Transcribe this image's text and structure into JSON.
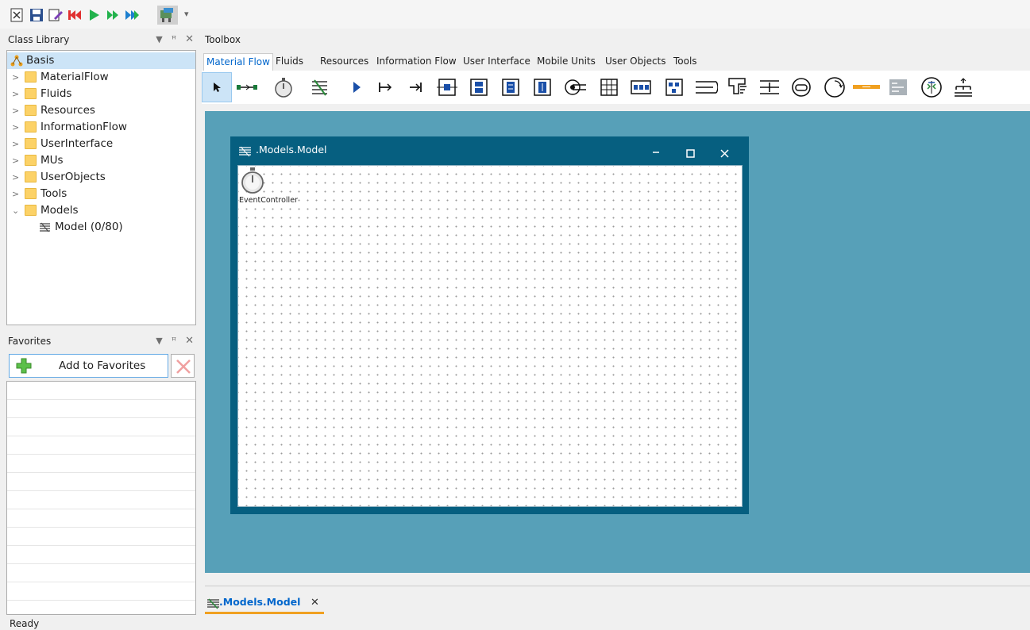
{
  "quick_access": {
    "buttons": [
      "new-icon",
      "save-icon",
      "open-icon",
      "reset-icon",
      "start-icon",
      "step-icon",
      "fast-forward-icon",
      "3d-view-icon"
    ],
    "overflow": "▾"
  },
  "class_library": {
    "title": "Class Library",
    "root": "Basis",
    "items": [
      {
        "label": "MaterialFlow",
        "expanded": false
      },
      {
        "label": "Fluids",
        "expanded": false
      },
      {
        "label": "Resources",
        "expanded": false
      },
      {
        "label": "InformationFlow",
        "expanded": false
      },
      {
        "label": "UserInterface",
        "expanded": false
      },
      {
        "label": "MUs",
        "expanded": false
      },
      {
        "label": "UserObjects",
        "expanded": false
      },
      {
        "label": "Tools",
        "expanded": false
      },
      {
        "label": "Models",
        "expanded": true
      }
    ],
    "model_item": "Model (0/80)"
  },
  "favorites": {
    "title": "Favorites",
    "add_label": "Add to Favorites"
  },
  "toolbox": {
    "title": "Toolbox",
    "tabs": [
      "Material Flow",
      "Fluids",
      "Resources",
      "Information Flow",
      "User Interface",
      "Mobile Units",
      "User Objects",
      "Tools"
    ],
    "active_tab": "Material Flow"
  },
  "model_window": {
    "title": ".Models.Model",
    "object_label": "EventController"
  },
  "document_tab": {
    "label": ".Models.Model",
    "close": "✕"
  },
  "status": {
    "text": "Ready"
  },
  "colors": {
    "workspace": "#57a0b8",
    "window_frame": "#065f80",
    "accent": "#0066cc",
    "tab_underline": "#f0a020"
  }
}
